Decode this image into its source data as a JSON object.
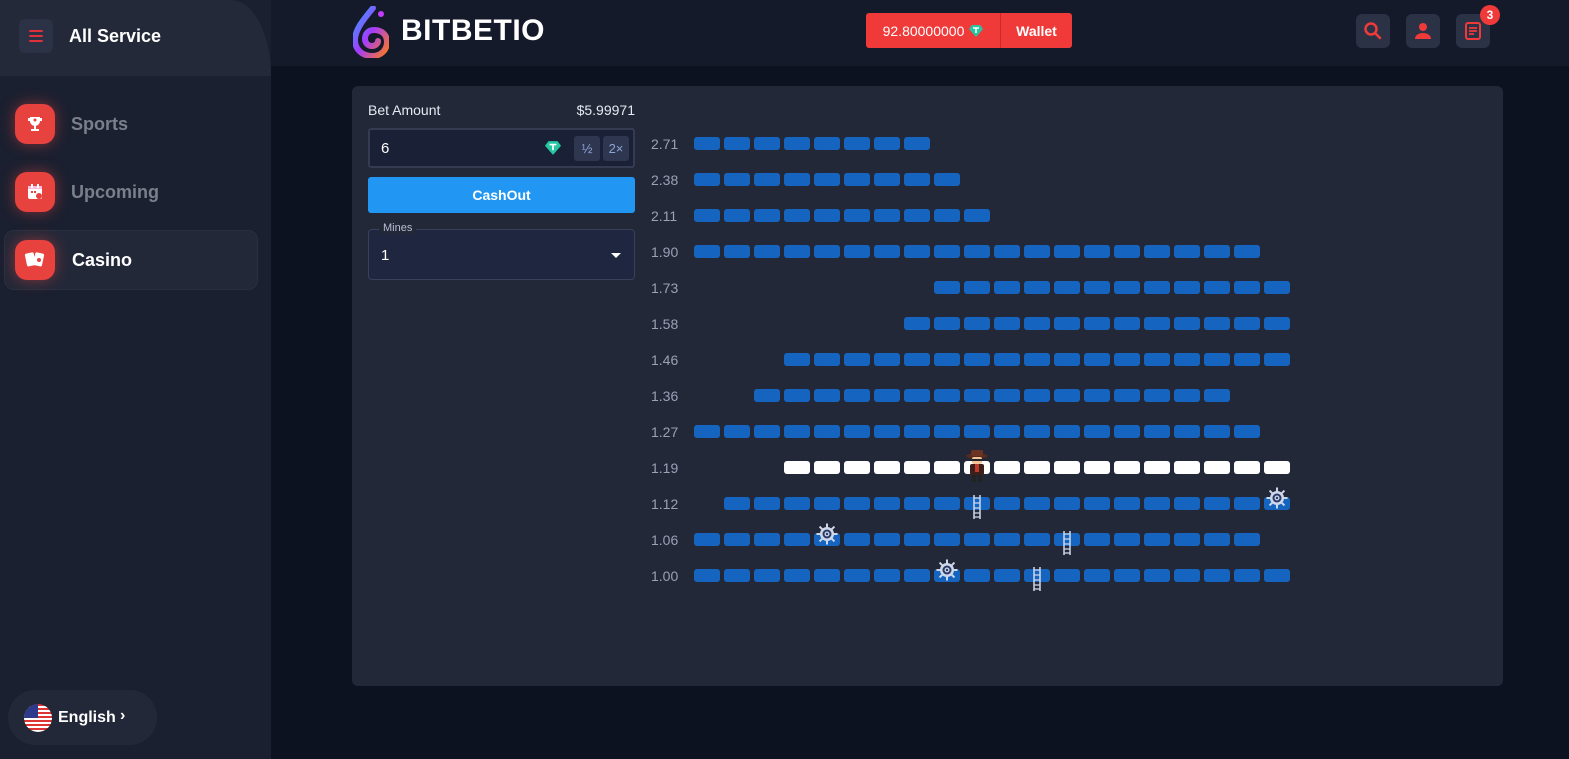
{
  "sidebar": {
    "title": "All Service",
    "menu_icon": "hamburger-icon",
    "items": [
      {
        "label": "Sports",
        "icon": "trophy-icon",
        "active": false
      },
      {
        "label": "Upcoming",
        "icon": "calendar-icon",
        "active": false
      },
      {
        "label": "Casino",
        "icon": "cards-icon",
        "active": true
      }
    ],
    "language": {
      "label": "English",
      "icon": "us-flag-icon"
    }
  },
  "header": {
    "brand": "BITBETIO",
    "balance": "92.80000000",
    "currency_icon": "usdt-gem-icon",
    "wallet_label": "Wallet",
    "notification_count": "3",
    "icons": [
      "search-icon",
      "user-icon",
      "notes-icon"
    ]
  },
  "bet_panel": {
    "bet_amount_label": "Bet Amount",
    "bet_amount_usd": "$5.99971",
    "bet_value": "6",
    "half_label": "½",
    "double_label": "2×",
    "cashout_label": "CashOut",
    "mines_label": "Mines",
    "mines_value": "1"
  },
  "colors": {
    "accent_red": "#f03a3a",
    "tile_blue": "#1565c0",
    "cashout_blue": "#2196f3"
  },
  "game": {
    "rows": [
      {
        "multiplier": "2.71",
        "start": 0,
        "count": 8
      },
      {
        "multiplier": "2.38",
        "start": 0,
        "count": 9
      },
      {
        "multiplier": "2.11",
        "start": 0,
        "count": 10
      },
      {
        "multiplier": "1.90",
        "start": 0,
        "count": 19
      },
      {
        "multiplier": "1.73",
        "start": 8,
        "count": 12
      },
      {
        "multiplier": "1.58",
        "start": 7,
        "count": 13
      },
      {
        "multiplier": "1.46",
        "start": 3,
        "count": 17
      },
      {
        "multiplier": "1.36",
        "start": 2,
        "count": 16
      },
      {
        "multiplier": "1.27",
        "start": 0,
        "count": 19
      },
      {
        "multiplier": "1.19",
        "start": 3,
        "count": 17,
        "revealed": true
      },
      {
        "multiplier": "1.12",
        "start": 1,
        "count": 19
      },
      {
        "multiplier": "1.06",
        "start": 0,
        "count": 19
      },
      {
        "multiplier": "1.00",
        "start": 0,
        "count": 20
      }
    ],
    "player": {
      "row": 9,
      "col": 9
    },
    "mines": [
      {
        "row": 10,
        "col": 19
      },
      {
        "row": 11,
        "col": 4
      },
      {
        "row": 12,
        "col": 8
      }
    ],
    "ladders": [
      {
        "row": 10,
        "col": 9
      },
      {
        "row": 11,
        "col": 12
      },
      {
        "row": 12,
        "col": 11
      }
    ]
  }
}
